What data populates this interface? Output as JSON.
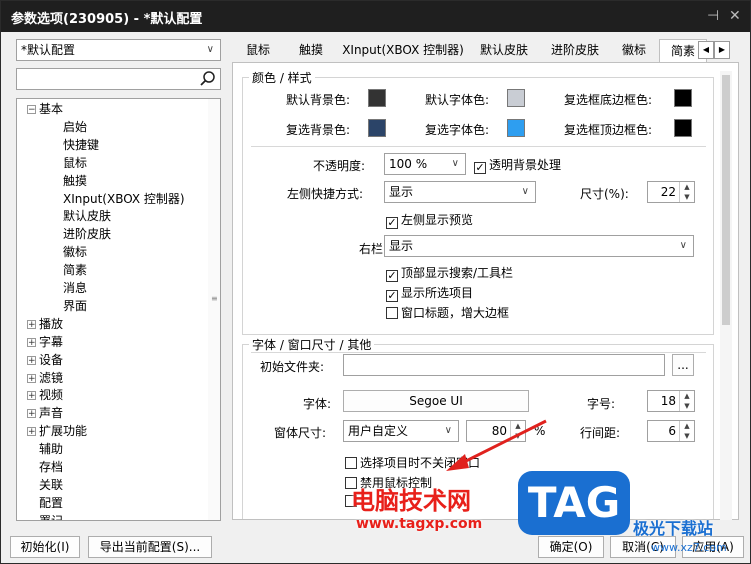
{
  "window": {
    "title": "参数选项(230905) - *默认配置",
    "pin": "⊣",
    "close": "✕"
  },
  "left": {
    "profile_combo": "*默认配置",
    "tree": [
      {
        "label": "基本",
        "expander": "−",
        "level": 0
      },
      {
        "label": "启始",
        "level": 1
      },
      {
        "label": "快捷键",
        "level": 1
      },
      {
        "label": "鼠标",
        "level": 1
      },
      {
        "label": "触摸",
        "level": 1
      },
      {
        "label": "XInput(XBOX 控制器)",
        "level": 1
      },
      {
        "label": "默认皮肤",
        "level": 1
      },
      {
        "label": "进阶皮肤",
        "level": 1
      },
      {
        "label": "徽标",
        "level": 1
      },
      {
        "label": "简素",
        "level": 1
      },
      {
        "label": "消息",
        "level": 1
      },
      {
        "label": "界面",
        "level": 1
      },
      {
        "label": "播放",
        "expander": "+",
        "level": 0
      },
      {
        "label": "字幕",
        "expander": "+",
        "level": 0
      },
      {
        "label": "设备",
        "expander": "+",
        "level": 0
      },
      {
        "label": "滤镜",
        "expander": "+",
        "level": 0
      },
      {
        "label": "视频",
        "expander": "+",
        "level": 0
      },
      {
        "label": "声音",
        "expander": "+",
        "level": 0
      },
      {
        "label": "扩展功能",
        "expander": "+",
        "level": 0
      },
      {
        "label": "辅助",
        "level": 0
      },
      {
        "label": "存档",
        "level": 0
      },
      {
        "label": "关联",
        "level": 0
      },
      {
        "label": "配置",
        "level": 0
      },
      {
        "label": "署记",
        "level": 0
      }
    ]
  },
  "tabs": [
    {
      "label": "鼠标"
    },
    {
      "label": "触摸"
    },
    {
      "label": "XInput(XBOX 控制器)"
    },
    {
      "label": "默认皮肤"
    },
    {
      "label": "进阶皮肤"
    },
    {
      "label": "徽标"
    },
    {
      "label": "简素",
      "active": true
    }
  ],
  "colors_group": {
    "title": "颜色 / 样式",
    "items": [
      {
        "label": "默认背景色:",
        "color": "#333333"
      },
      {
        "label": "默认字体色:",
        "color": "#c9cdd4"
      },
      {
        "label": "复选框底边框色:",
        "color": "#000000"
      },
      {
        "label": "复选背景色:",
        "color": "#2b4468"
      },
      {
        "label": "复选字体色:",
        "color": "#2e9ef0"
      },
      {
        "label": "复选框顶边框色:",
        "color": "#000000"
      }
    ],
    "opacity_label": "不透明度:",
    "opacity_value": "100 %",
    "transparent_bg": "透明背景处理",
    "left_shortcut_label": "左侧快捷方式:",
    "left_shortcut_value": "显示",
    "size_label": "尺寸(%):",
    "size_value": "22",
    "left_preview": "左侧显示预览",
    "right_bar_label": "右栏:",
    "right_bar_value": "显示",
    "top_search": "顶部显示搜索/工具栏",
    "show_selected": "显示所选项目",
    "window_title": "窗口标题，增大边框"
  },
  "font_group": {
    "title": "字体 / 窗口尺寸 / 其他",
    "init_folder_label": "初始文件夹:",
    "browse": "...",
    "font_label": "字体:",
    "font_value": "Segoe UI",
    "font_size_label": "字号:",
    "font_size_value": "18",
    "window_size_label": "窗体尺寸:",
    "window_size_mode": "用户自定义",
    "window_size_value": "80",
    "percent": "%",
    "line_spacing_label": "行间距:",
    "line_spacing_value": "6",
    "no_close": "选择项目时不关闭窗口",
    "disable_mouse": "禁用鼠标控制"
  },
  "bottom": {
    "reset": "初始化(I)",
    "export": "导出当前配置(S)...",
    "ok": "确定(O)",
    "cancel": "取消(C)",
    "apply": "应用(A)"
  },
  "watermark": {
    "brand": "电脑技术网",
    "url": "www.tagxp.com",
    "logo": "TAG",
    "site": "极光下载站",
    "site_url": "www.xz7.com"
  }
}
